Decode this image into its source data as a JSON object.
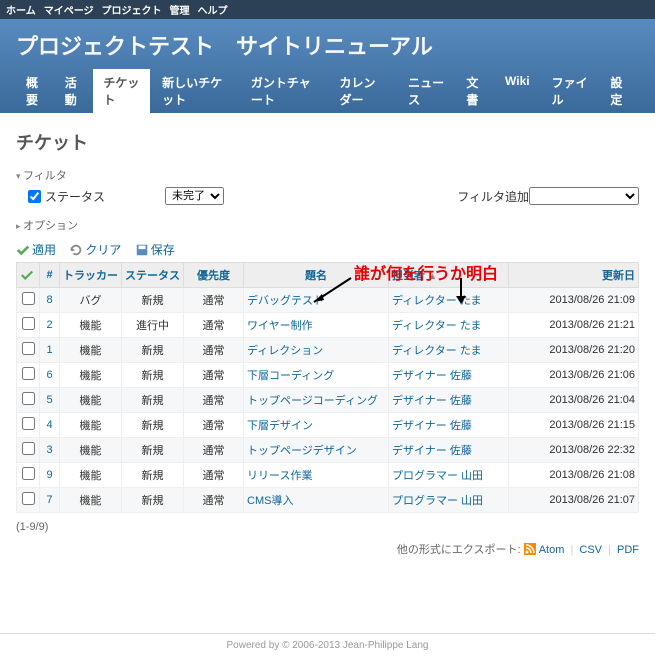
{
  "topMenu": [
    "ホーム",
    "マイページ",
    "プロジェクト",
    "管理",
    "ヘルプ"
  ],
  "header": {
    "title": "プロジェクトテスト　サイトリニューアル"
  },
  "mainMenu": [
    {
      "label": "概要",
      "selected": false
    },
    {
      "label": "活動",
      "selected": false
    },
    {
      "label": "チケット",
      "selected": true
    },
    {
      "label": "新しいチケット",
      "selected": false
    },
    {
      "label": "ガントチャート",
      "selected": false
    },
    {
      "label": "カレンダー",
      "selected": false
    },
    {
      "label": "ニュース",
      "selected": false
    },
    {
      "label": "文書",
      "selected": false
    },
    {
      "label": "Wiki",
      "selected": false
    },
    {
      "label": "ファイル",
      "selected": false
    },
    {
      "label": "設定",
      "selected": false
    }
  ],
  "page": {
    "heading": "チケット"
  },
  "filters": {
    "legend": "フィルタ",
    "statusLabel": "ステータス",
    "statusValue": "未完了",
    "addFilterLabel": "フィルタ追加",
    "addFilterPlaceholder": ""
  },
  "options": {
    "legend": "オプション"
  },
  "buttons": {
    "apply": "適用",
    "clear": "クリア",
    "save": "保存"
  },
  "annotation": {
    "text": "誰が何を行うか明白"
  },
  "columns": {
    "id": "#",
    "tracker": "トラッカー",
    "status": "ステータス",
    "priority": "優先度",
    "subject": "題名",
    "assignee": "担当者",
    "updated": "更新日"
  },
  "issues": [
    {
      "id": "8",
      "tracker": "バグ",
      "status": "新規",
      "priority": "通常",
      "subject": "デバッグテスト",
      "assignee": "ディレクター たま",
      "updated": "2013/08/26 21:09"
    },
    {
      "id": "2",
      "tracker": "機能",
      "status": "進行中",
      "priority": "通常",
      "subject": "ワイヤー制作",
      "assignee": "ディレクター たま",
      "updated": "2013/08/26 21:21"
    },
    {
      "id": "1",
      "tracker": "機能",
      "status": "新規",
      "priority": "通常",
      "subject": "ディレクション",
      "assignee": "ディレクター たま",
      "updated": "2013/08/26 21:20"
    },
    {
      "id": "6",
      "tracker": "機能",
      "status": "新規",
      "priority": "通常",
      "subject": "下層コーディング",
      "assignee": "デザイナー 佐藤",
      "updated": "2013/08/26 21:06"
    },
    {
      "id": "5",
      "tracker": "機能",
      "status": "新規",
      "priority": "通常",
      "subject": "トップページコーディング",
      "assignee": "デザイナー 佐藤",
      "updated": "2013/08/26 21:04"
    },
    {
      "id": "4",
      "tracker": "機能",
      "status": "新規",
      "priority": "通常",
      "subject": "下層デザイン",
      "assignee": "デザイナー 佐藤",
      "updated": "2013/08/26 21:15"
    },
    {
      "id": "3",
      "tracker": "機能",
      "status": "新規",
      "priority": "通常",
      "subject": "トップページデザイン",
      "assignee": "デザイナー 佐藤",
      "updated": "2013/08/26 22:32"
    },
    {
      "id": "9",
      "tracker": "機能",
      "status": "新規",
      "priority": "通常",
      "subject": "リリース作業",
      "assignee": "プログラマー 山田",
      "updated": "2013/08/26 21:08"
    },
    {
      "id": "7",
      "tracker": "機能",
      "status": "新規",
      "priority": "通常",
      "subject": "CMS導入",
      "assignee": "プログラマー 山田",
      "updated": "2013/08/26 21:07"
    }
  ],
  "pagination": "(1-9/9)",
  "otherFormats": {
    "label": "他の形式にエクスポート:",
    "atom": "Atom",
    "csv": "CSV",
    "pdf": "PDF"
  },
  "footer": "Powered by © 2006-2013 Jean-Philippe Lang"
}
